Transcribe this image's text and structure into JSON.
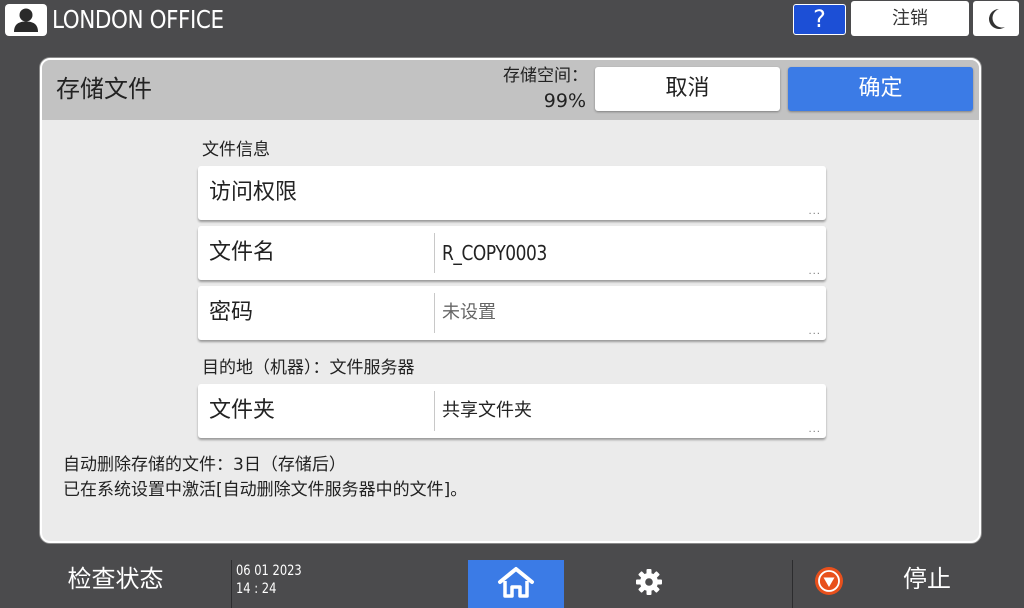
{
  "topbar": {
    "user_icon": "user-icon",
    "office_name": "LONDON OFFICE",
    "help_label": "?",
    "logout_label": "注销",
    "sleep_icon": "moon-icon"
  },
  "dialog": {
    "title": "存储文件",
    "storage_label": "存储空间：",
    "storage_value": "99%",
    "cancel_label": "取消",
    "ok_label": "确定",
    "file_info_label": "文件信息",
    "access_rights_label": "访问权限",
    "file_name": {
      "label": "文件名",
      "value": "R_COPY0003"
    },
    "password": {
      "label": "密码",
      "value": "未设置"
    },
    "destination_label": "目的地（机器）：文件服务器",
    "folder": {
      "label": "文件夹",
      "value": "共享文件夹"
    },
    "more_indicator": "...",
    "note_line1": "自动删除存储的文件：3日（存储后）",
    "note_line2": "已在系统设置中激活[自动删除文件服务器中的文件]。"
  },
  "bottombar": {
    "check_status_label": "检查状态",
    "date": "06 01 2023",
    "time": "14 : 24",
    "home_icon": "home-icon",
    "settings_icon": "gear-icon",
    "stop_label": "停止",
    "stop_icon": "stop-icon",
    "colors": {
      "accent": "#3b7be6",
      "stop": "#e8501c"
    }
  }
}
